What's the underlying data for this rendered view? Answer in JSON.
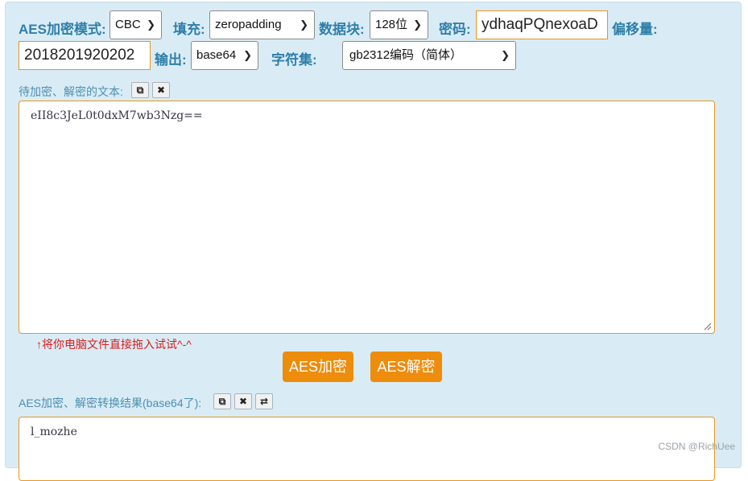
{
  "toolbar": {
    "mode_label": "AES加密模式:",
    "mode_value": "CBC",
    "padding_label": "填充:",
    "padding_value": "zeropadding",
    "block_label": "数据块:",
    "block_value": "128位",
    "password_label": "密码:",
    "password_value": "ydhaqPQnexoaD",
    "offset_label": "偏移量:",
    "offset_value": "2018201920202",
    "output_label": "输出:",
    "output_value": "base64",
    "charset_label": "字符集:",
    "charset_value": "gb2312编码（简体）"
  },
  "input_area": {
    "label": "待加密、解密的文本:",
    "text": "eII8c3JeL0t0dxM7wb3Nzg==",
    "hint": "↑将你电脑文件直接拖入试试^-^"
  },
  "actions": {
    "encrypt_label": "AES加密",
    "decrypt_label": "AES解密"
  },
  "output_area": {
    "label": "AES加密、解密转换结果(base64了):",
    "text": "l_mozhe"
  },
  "watermark": "CSDN @RichUee",
  "icons": {
    "copy": "copy-icon",
    "clear": "close-icon",
    "swap": "swap-icon"
  },
  "colors": {
    "panel_bg": "#d9ecf5",
    "label_blue": "#2f7fa8",
    "accent_orange": "#ee8c0c",
    "hint_red": "#d91c1c"
  }
}
